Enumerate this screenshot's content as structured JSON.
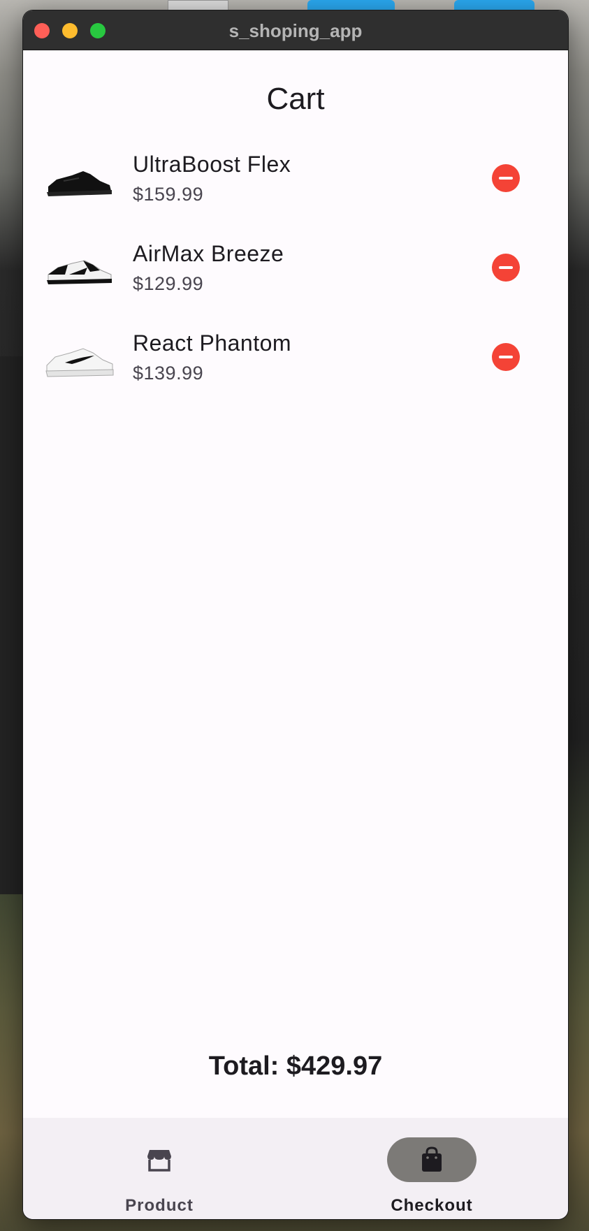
{
  "window": {
    "title": "s_shoping_app"
  },
  "page": {
    "title": "Cart"
  },
  "cart": {
    "items": [
      {
        "name": "UltraBoost Flex",
        "price": "$159.99",
        "image": "black-sneaker"
      },
      {
        "name": "AirMax Breeze",
        "price": "$129.99",
        "image": "black-white-sneaker"
      },
      {
        "name": "React Phantom",
        "price": "$139.99",
        "image": "white-sneaker"
      }
    ],
    "total_label": "Total: $429.97"
  },
  "nav": {
    "items": [
      {
        "label": "Product",
        "icon": "store-icon",
        "selected": false
      },
      {
        "label": "Checkout",
        "icon": "shopping-bag-icon",
        "selected": true
      }
    ]
  },
  "colors": {
    "remove": "#f44336",
    "nav_selected_pill": "#7c7a77",
    "background": "#fefbfe",
    "navbar": "#f3eff4"
  }
}
